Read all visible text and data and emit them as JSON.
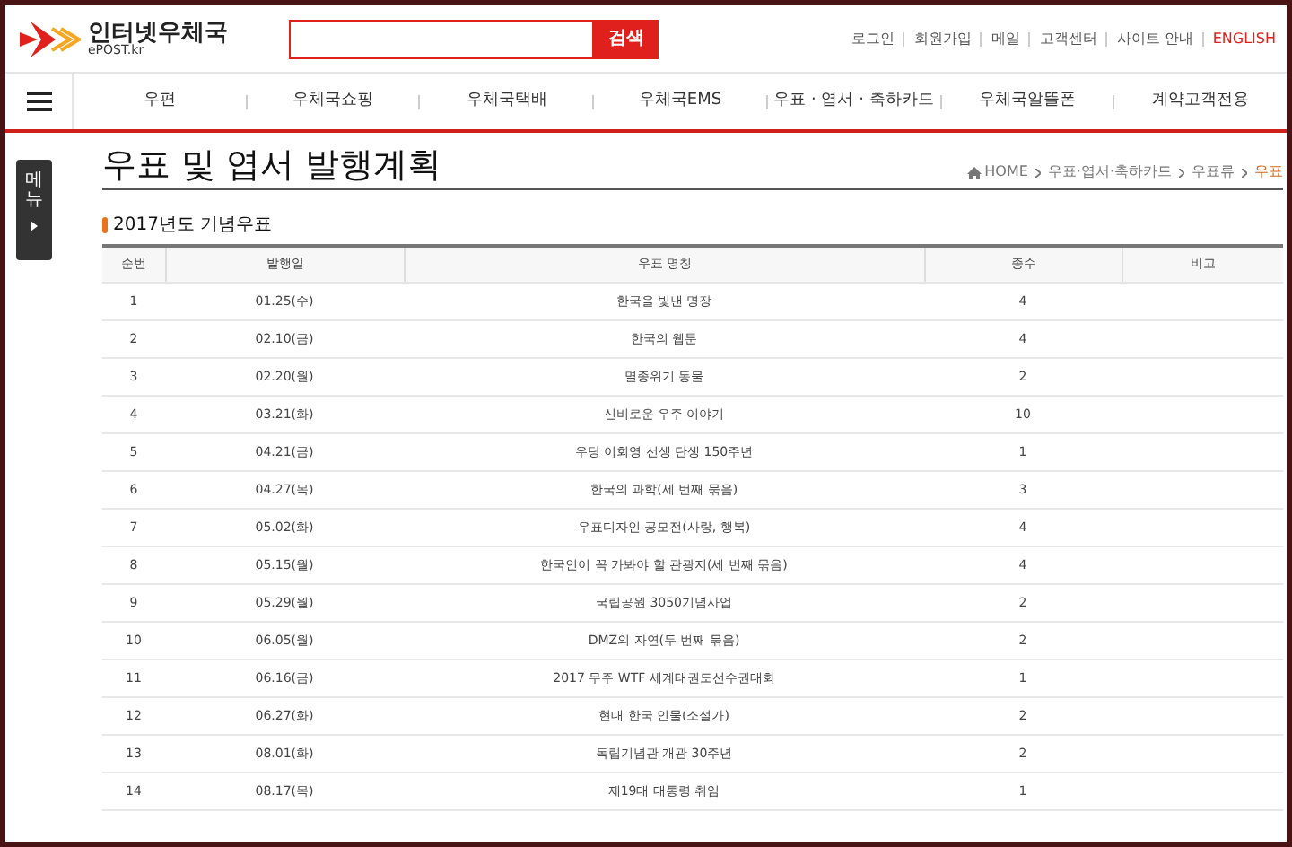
{
  "logo": {
    "title": "인터넷우체국",
    "subtitle": "ePOST.kr"
  },
  "search": {
    "button": "검색"
  },
  "top_links": [
    {
      "label": "로그인",
      "kind": "normal"
    },
    {
      "label": "회원가입",
      "kind": "normal"
    },
    {
      "label": "메일",
      "kind": "normal"
    },
    {
      "label": "고객센터",
      "kind": "normal"
    },
    {
      "label": "사이트 안내",
      "kind": "normal"
    },
    {
      "label": "ENGLISH",
      "kind": "highlight"
    }
  ],
  "nav": [
    "우편",
    "우체국쇼핑",
    "우체국택배",
    "우체국EMS",
    "우표 · 엽서 · 축하카드",
    "우체국알뜰폰",
    "계약고객전용"
  ],
  "side_menu": {
    "label": "메뉴"
  },
  "page_title": "우표 및 엽서 발행계획",
  "breadcrumb": [
    {
      "label": "HOME",
      "selected": false
    },
    {
      "label": "우표·엽서·축하카드",
      "selected": false
    },
    {
      "label": "우표류",
      "selected": false
    },
    {
      "label": "우표",
      "selected": true
    }
  ],
  "section_title": "2017년도 기념우표",
  "table": {
    "columns": [
      "순번",
      "발행일",
      "우표 명칭",
      "종수",
      "비고"
    ],
    "rows": [
      [
        "1",
        "01.25(수)",
        "한국을 빛낸 명장",
        "4"
      ],
      [
        "2",
        "02.10(금)",
        "한국의 웹툰",
        "4"
      ],
      [
        "3",
        "02.20(월)",
        "멸종위기 동물",
        "2"
      ],
      [
        "4",
        "03.21(화)",
        "신비로운 우주 이야기",
        "10"
      ],
      [
        "5",
        "04.21(금)",
        "우당 이회영 선생 탄생 150주년",
        "1"
      ],
      [
        "6",
        "04.27(목)",
        "한국의 과학(세 번째 묶음)",
        "3"
      ],
      [
        "7",
        "05.02(화)",
        "우표디자인 공모전(사랑, 행복)",
        "4"
      ],
      [
        "8",
        "05.15(월)",
        "한국인이 꼭 가봐야 할 관광지(세 번째 묶음)",
        "4"
      ],
      [
        "9",
        "05.29(월)",
        "국립공원 3050기념사업",
        "2"
      ],
      [
        "10",
        "06.05(월)",
        "DMZ의 자연(두 번째 묶음)",
        "2"
      ],
      [
        "11",
        "06.16(금)",
        "2017 무주 WTF 세계태권도선수권대회",
        "1"
      ],
      [
        "12",
        "06.27(화)",
        "현대 한국 인물(소설가)",
        "2"
      ],
      [
        "13",
        "08.01(화)",
        "독립기념관 개관 30주년",
        "2"
      ],
      [
        "14",
        "08.17(목)",
        "제19대 대통령 취임",
        "1"
      ]
    ]
  }
}
